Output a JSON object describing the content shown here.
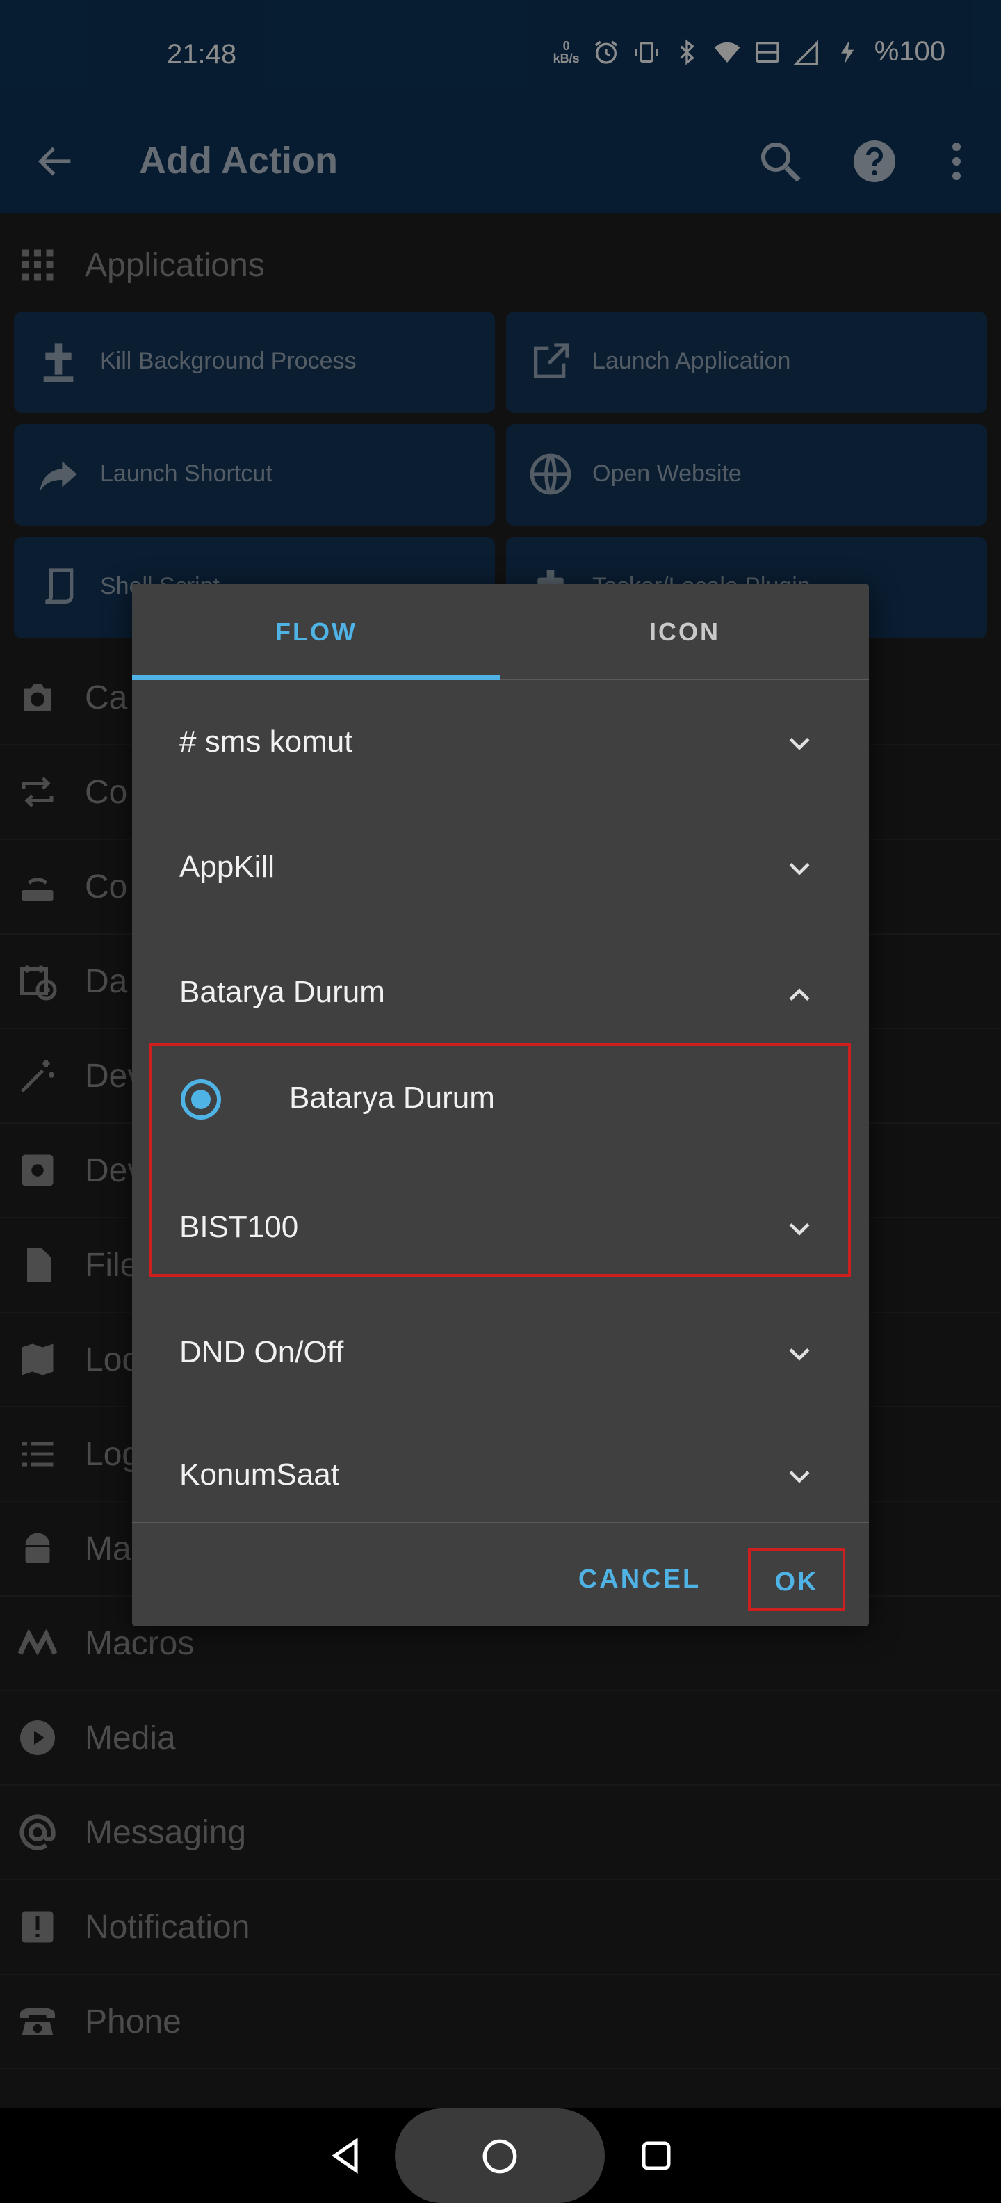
{
  "status_bar": {
    "time": "21:48",
    "net_speed_value": "0",
    "net_speed_unit": "kB/s",
    "battery": "%100",
    "icons": [
      "alarm-icon",
      "vibrate-icon",
      "bluetooth-icon",
      "wifi-icon",
      "vowifi-icon",
      "signal-icon",
      "charging-icon"
    ]
  },
  "toolbar": {
    "title": "Add Action",
    "icons": [
      "back-arrow-icon",
      "search-icon",
      "help-icon",
      "more-vert-icon"
    ]
  },
  "background": {
    "section_title": "Applications",
    "tiles": [
      {
        "label": "Kill Background Process",
        "icon": "tombstone-icon"
      },
      {
        "label": "Launch Application",
        "icon": "open-external-icon"
      },
      {
        "label": "Launch Shortcut",
        "icon": "share-arrow-icon"
      },
      {
        "label": "Open Website",
        "icon": "globe-icon"
      },
      {
        "label": "Shell Script",
        "icon": "script-icon"
      },
      {
        "label": "Tasker/Locale Plugin",
        "icon": "plugin-icon"
      }
    ],
    "partial_categories": [
      {
        "label": "Ca",
        "icon": "camera-icon"
      },
      {
        "label": "Co",
        "icon": "repeat-icon"
      },
      {
        "label": "Co",
        "icon": "router-icon"
      },
      {
        "label": "Da",
        "icon": "calendar-clock-icon"
      },
      {
        "label": "Dev",
        "icon": "magic-wand-icon"
      },
      {
        "label": "Dev",
        "icon": "settings-box-icon"
      },
      {
        "label": "File",
        "icon": "file-icon"
      },
      {
        "label": "Loc",
        "icon": "map-icon"
      },
      {
        "label": "Log",
        "icon": "list-icon"
      },
      {
        "label": "Ma",
        "icon": "android-icon"
      }
    ],
    "categories": [
      {
        "label": "Macros",
        "icon": "macrodroid-icon"
      },
      {
        "label": "Media",
        "icon": "play-circle-icon"
      },
      {
        "label": "Messaging",
        "icon": "at-icon"
      },
      {
        "label": "Notification",
        "icon": "alert-box-icon"
      },
      {
        "label": "Phone",
        "icon": "phone-icon"
      }
    ]
  },
  "dialog": {
    "tabs": [
      {
        "label": "FLOW",
        "active": true
      },
      {
        "label": "ICON",
        "active": false
      }
    ],
    "groups": [
      {
        "label": "# sms komut",
        "expanded": false
      },
      {
        "label": "AppKill",
        "expanded": false
      },
      {
        "label": "Batarya Durum",
        "expanded": true
      },
      {
        "label": "BIST100",
        "expanded": false
      },
      {
        "label": "DND On/Off",
        "expanded": false
      },
      {
        "label": "KonumSaat",
        "expanded": false
      }
    ],
    "selected_item": "Batarya Durum",
    "cancel_label": "CANCEL",
    "ok_label": "OK"
  },
  "colors": {
    "accent": "#4fb3e6",
    "appbar": "#0d3458",
    "dialog_bg": "#404040",
    "highlight_border": "#cc1f1f"
  }
}
